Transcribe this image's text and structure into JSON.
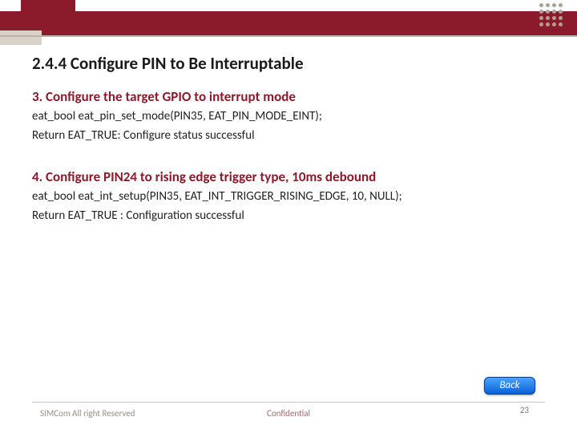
{
  "title": "2.4.4 Configure PIN to Be Interruptable",
  "section1": {
    "heading": "3. Configure the target GPIO to interrupt mode",
    "code": "eat_bool eat_pin_set_mode(PIN35, EAT_PIN_MODE_EINT);",
    "result": "Return EAT_TRUE: Configure status successful"
  },
  "section2": {
    "heading": "4. Configure PIN24 to rising edge trigger type, 10ms debound",
    "code": "eat_bool eat_int_setup(PIN35, EAT_INT_TRIGGER_RISING_EDGE, 10, NULL);",
    "result": "Return EAT_TRUE : Configuration successful"
  },
  "back_label": "Back",
  "footer": {
    "left": "SIMCom All right Reserved",
    "center": "Confidential",
    "page": "23"
  }
}
